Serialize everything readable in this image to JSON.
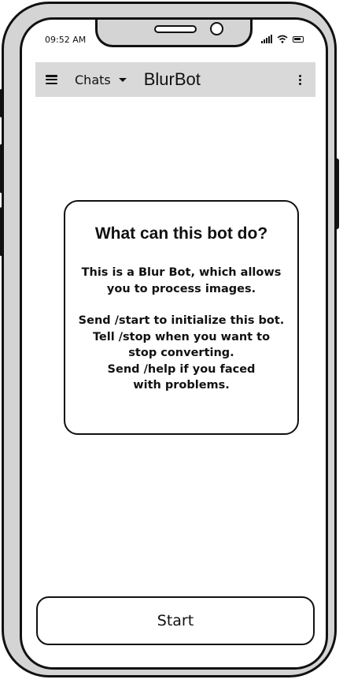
{
  "status_bar": {
    "time": "09:52 AM"
  },
  "toolbar": {
    "chats_label": "Chats",
    "title": "BlurBot"
  },
  "info_card": {
    "title": "What can this bot do?",
    "lines": [
      "This is a Blur Bot, which allows you to process images.",
      "Send /start to initialize this bot.",
      "Tell /stop when you want to stop converting.",
      "Send /help if you faced with problems."
    ]
  },
  "start_button": {
    "label": "Start"
  },
  "icons": {
    "menu": "hamburger-icon",
    "dropdown": "caret-down-icon",
    "more": "kebab-icon",
    "signal": "signal-icon",
    "wifi": "wifi-icon",
    "battery": "battery-icon"
  },
  "colors": {
    "toolbar_bg": "#d9d9d9",
    "frame_bg": "#d4d4d4",
    "stroke": "#111111"
  }
}
